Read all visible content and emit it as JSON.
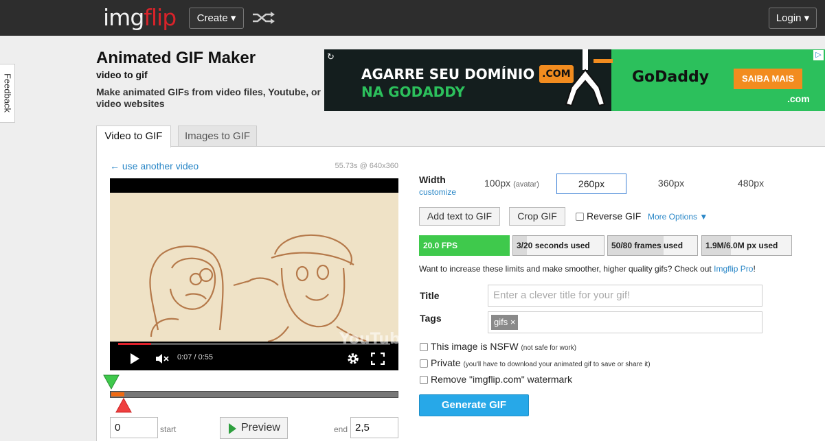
{
  "topbar": {
    "logo_main": "img",
    "logo_accent": "flip",
    "create_label": "Create ▾",
    "login_label": "Login ▾"
  },
  "feedback_label": "Feedback",
  "header": {
    "title": "Animated GIF Maker",
    "subtitle": "video to gif",
    "description": "Make animated GIFs from video files, Youtube, or video websites"
  },
  "ad": {
    "line1": "AGARRE SEU DOMÍNIO",
    "line1_badge": ".COM",
    "line2": "NA GODADDY",
    "brand": "GoDaddy",
    "cta": "SAIBA MAIS",
    "tld": ".com"
  },
  "tabs": [
    {
      "label": "Video to GIF",
      "active": true
    },
    {
      "label": "Images to GIF",
      "active": false
    }
  ],
  "video": {
    "back_link": "← use another video",
    "info": "55.73s @ 640x360",
    "time": "0:07 / 0:55",
    "played_fraction": 0.12,
    "watermark": "YouTube"
  },
  "trim": {
    "start_value": "0",
    "start_label": "start",
    "end_label": "end",
    "end_value": "2,5",
    "preview_label": "Preview"
  },
  "options": {
    "width_label": "Width",
    "customize_label": "customize",
    "widths": [
      {
        "label": "100px",
        "note": "(avatar)",
        "selected": false
      },
      {
        "label": "260px",
        "note": "",
        "selected": true
      },
      {
        "label": "360px",
        "note": "",
        "selected": false
      },
      {
        "label": "480px",
        "note": "",
        "selected": false
      }
    ],
    "add_text_label": "Add text to GIF",
    "crop_label": "Crop GIF",
    "reverse_label": "Reverse GIF",
    "more_options_label": "More Options ▼"
  },
  "meters": [
    {
      "label": "20.0 FPS",
      "fill": 1.0
    },
    {
      "label": "3/20 seconds used",
      "fill": 0.15
    },
    {
      "label": "50/80 frames used",
      "fill": 0.625
    },
    {
      "label": "1.9M/6.0M px used",
      "fill": 0.32
    }
  ],
  "limits": {
    "text": "Want to increase these limits and make smoother, higher quality gifs? Check out ",
    "link": "Imgflip Pro",
    "suffix": "!"
  },
  "form": {
    "title_label": "Title",
    "title_placeholder": "Enter a clever title for your gif!",
    "tags_label": "Tags",
    "tag_chip": "gifs ×"
  },
  "checkboxes": [
    {
      "label": "This image is NSFW",
      "note": "(not safe for work)"
    },
    {
      "label": "Private",
      "note": "(you'll have to download your animated gif to save or share it)"
    },
    {
      "label": "Remove \"imgflip.com\" watermark",
      "note": ""
    }
  ],
  "generate_label": "Generate GIF",
  "colors": {
    "accent_blue": "#27a8e8",
    "link_blue": "#2a87c7",
    "fps_green": "#3fc94c",
    "logo_red": "#d8232a",
    "trim_orange": "#f06a13"
  }
}
